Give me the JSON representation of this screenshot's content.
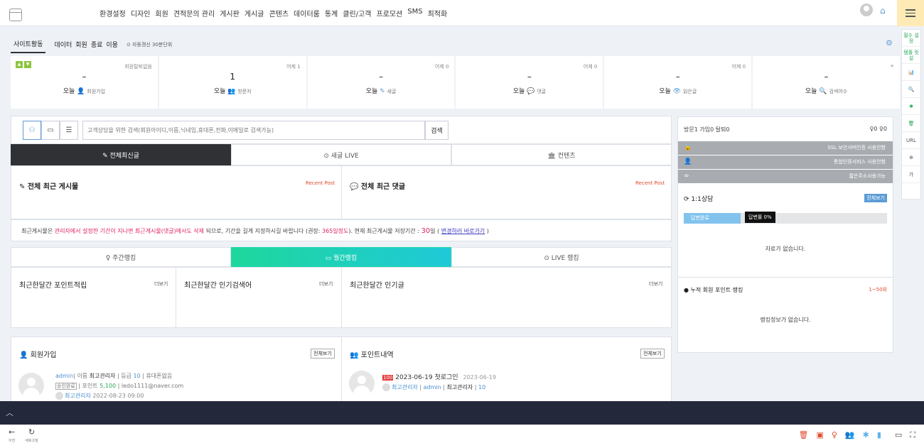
{
  "nav": [
    "환경설정",
    "디자인",
    "회원",
    "견적문의 관리",
    "게시판",
    "게시글",
    "콘텐츠",
    "데이터룸",
    "통계",
    "클린/고객",
    "프로모션",
    "SMS",
    "최적화"
  ],
  "tabs": {
    "t1": "사이트활동",
    "t2": "데이터",
    "t3": "회원",
    "t4": "종료",
    "t5": "이용",
    "auto": "⊙ 자동갱신 30분단위"
  },
  "right_bar": [
    "필수\n설정",
    "템플\n릿설",
    "📊",
    "🔍",
    "✱",
    "🗑",
    "URL",
    "⊕",
    "가"
  ],
  "stats": [
    {
      "tr": "회원탈퇴없음",
      "val": "–",
      "pre": "오늘",
      "icon": "👤",
      "lbl": "회원가입"
    },
    {
      "tr": "어제 1",
      "val": "1",
      "pre": "오늘",
      "icon": "👥",
      "lbl": "방문자"
    },
    {
      "tr": "어제 0",
      "val": "–",
      "pre": "오늘",
      "icon": "✎",
      "lbl": "새글"
    },
    {
      "tr": "어제 0",
      "val": "–",
      "pre": "오늘",
      "icon": "💬",
      "lbl": "댓글"
    },
    {
      "tr": "어제 0",
      "val": "–",
      "pre": "오늘",
      "icon": "👁",
      "lbl": "읽은글"
    },
    {
      "tr": "+",
      "val": "–",
      "pre": "오늘",
      "icon": "🔍",
      "lbl": "검색어수"
    }
  ],
  "search": {
    "placeholder": "고객상담을 위한 검색(회원아이디,이름,닉네임,휴대폰,전화,이메일로 검색가능)",
    "button": "검색"
  },
  "tabrow1": [
    "✎ 전체최신글",
    "⊙ 새글 LIVE",
    "🏛 컨텐츠"
  ],
  "posts": {
    "left_title": "✎ 전체 최근 게시물",
    "left_tag": "Recent Post",
    "right_title": "💬 전체 최근 댓글",
    "right_tag": "Recent Post"
  },
  "notice": {
    "a": "최근게시물은 ",
    "b": "관리자에서 설정한 기간이 지나면 최근게시물(댓글)에서도 삭제",
    "c": " 되므로, 기간을 길게 지정하시길 바랍니다 (권장: ",
    "d": "365일정도",
    "e": ").    현재 최근게시물 저장기간 : ",
    "f": "30",
    "g": "일 ( ",
    "h": "변경하러 바로가기",
    "i": " )"
  },
  "tabrow2": [
    "♀ 주간랭킹",
    "▭ 월간랭킹",
    "⊙ LIVE 랭킹"
  ],
  "rank": [
    {
      "title": "최근한달간 포인트적립",
      "more": "더보기"
    },
    {
      "title": "최근한달간 인기검색어",
      "more": "더보기"
    },
    {
      "title": "최근한달간 인기글",
      "more": "더보기"
    }
  ],
  "member": {
    "title": "회원가입",
    "btn": "전체보기",
    "id": "admin",
    "name_lbl": "| 이름 ",
    "name": "최고관리자",
    "lv_lbl": " | 등급 ",
    "lv": "10",
    "phone": " | 휴대폰없음",
    "badge": "승인완료",
    "pt_lbl": " | 포인트 ",
    "pt": "5,100",
    "email": " | ledo1111@naver.com",
    "by": "최고관리자",
    "date": "2022-08-23 09:00"
  },
  "point": {
    "title": "포인트내역",
    "btn": "전체보기",
    "amt": "100",
    "date": "2023-06-19",
    "desc": "첫로그인",
    "date2": "2023-06-19",
    "by": "최고관리자",
    "id": "admin",
    "name": "최고관리자",
    "lv": "10"
  },
  "side": {
    "top": "방문1 가입0 탈퇴0",
    "topr": "♀0 ♀0",
    "g1": "SSL 보안서버인증 사용안함",
    "g2": "통합인증서비스 사용안함",
    "g3": "짧은주소사용가능",
    "cs": "⟳ 1:1상담",
    "cs_btn": "전체보기",
    "prog_fill": "답변완료",
    "prog_tip": "답변률 0%",
    "empty1": "자료가 없습니다.",
    "rank": "● 누적 회원 포인트 랭킹",
    "rank_r": "1~50위",
    "empty2": "랭킹정보가 없습니다."
  },
  "footer": {
    "back": "이전",
    "refresh": "새로고침"
  }
}
